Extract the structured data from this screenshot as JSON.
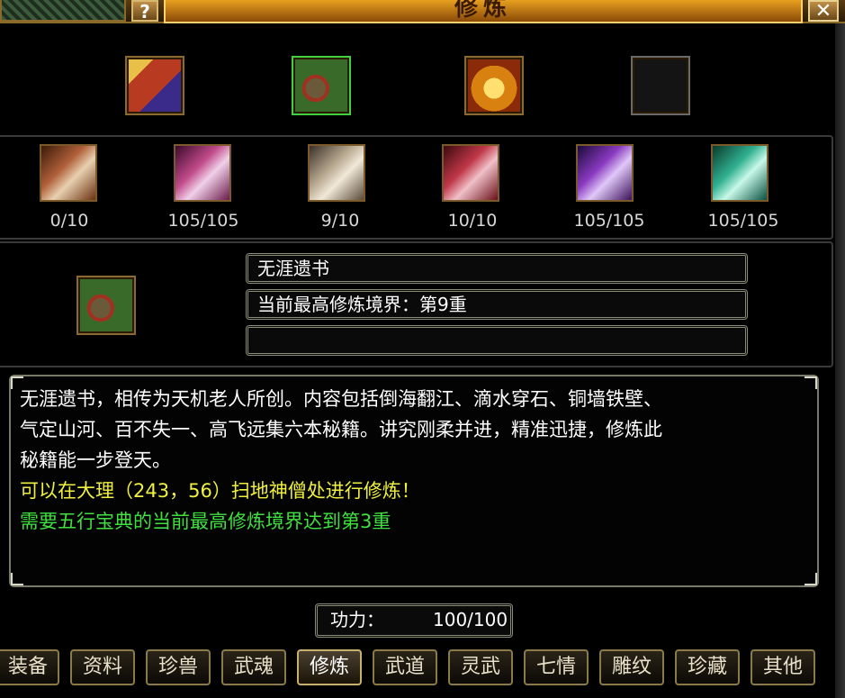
{
  "window": {
    "title": "修炼",
    "help_label": "?",
    "close_label": "✕"
  },
  "top_icons": [
    {
      "name": "book-icon"
    },
    {
      "name": "scroll-bundle-icon",
      "selected": true
    },
    {
      "name": "gold-chest-icon"
    },
    {
      "name": "empty-slot"
    }
  ],
  "scrolls": [
    {
      "count": "0/10",
      "color": "#b0603a"
    },
    {
      "count": "105/105",
      "color": "#c04a8a"
    },
    {
      "count": "9/10",
      "color": "#b8a890"
    },
    {
      "count": "10/10",
      "color": "#c03848"
    },
    {
      "count": "105/105",
      "color": "#8a3ac0"
    },
    {
      "count": "105/105",
      "color": "#30b090"
    }
  ],
  "selected": {
    "name": "无涯遗书",
    "realm": "当前最高修炼境界：第9重",
    "extra": ""
  },
  "description": {
    "line1": "无涯遗书，相传为天机老人所创。内容包括倒海翻江、滴水穿石、铜墙铁壁、",
    "line2": "气定山河、百不失一、高飞远集六本秘籍。讲究刚柔并进，精准迅捷，修炼此",
    "line3": "秘籍能一步登天。",
    "location": "可以在大理（243，56）扫地神僧处进行修炼！",
    "requirement": "需要五行宝典的当前最高修炼境界达到第3重"
  },
  "power": {
    "label": "功力：",
    "value": "100/100"
  },
  "tabs": [
    "装备",
    "资料",
    "珍兽",
    "武魂",
    "修炼",
    "武道",
    "灵武",
    "七情",
    "雕纹",
    "珍藏",
    "其他"
  ],
  "active_tab": 4,
  "colors": {
    "gold": "#e8a020",
    "yellow_text": "#f0f040",
    "green_text": "#40e040",
    "white_text": "#ffffff"
  }
}
